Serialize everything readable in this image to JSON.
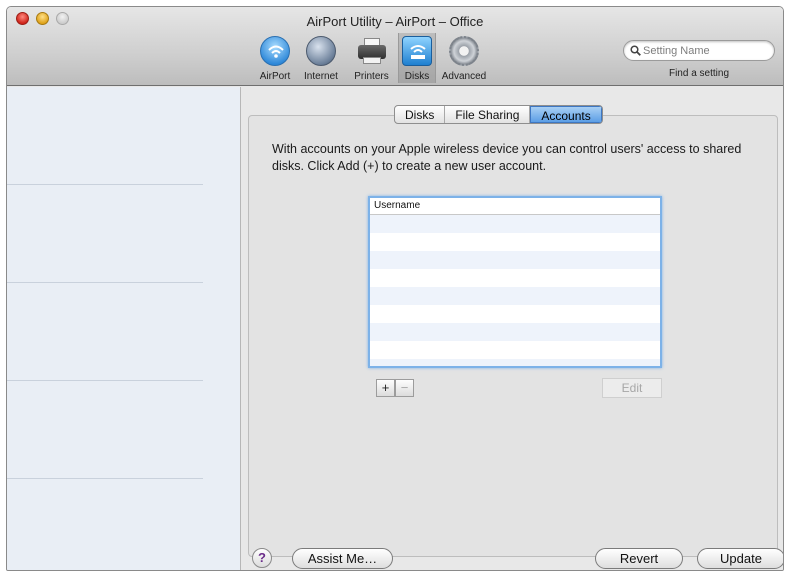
{
  "window": {
    "title": "AirPort Utility – AirPort – Office"
  },
  "toolbar": {
    "items": [
      {
        "label": "AirPort",
        "icon": "airport-wifi-icon"
      },
      {
        "label": "Internet",
        "icon": "internet-globe-icon"
      },
      {
        "label": "Printers",
        "icon": "printer-icon"
      },
      {
        "label": "Disks",
        "icon": "disks-icon"
      },
      {
        "label": "Advanced",
        "icon": "advanced-gear-icon"
      }
    ],
    "selected": "Disks",
    "search": {
      "placeholder": "Setting Name",
      "caption": "Find a setting"
    }
  },
  "tabs": [
    {
      "label": "Disks"
    },
    {
      "label": "File Sharing"
    },
    {
      "label": "Accounts"
    }
  ],
  "selected_tab": "Accounts",
  "accounts": {
    "description": "With accounts on your Apple wireless device you can control users' access to shared disks. Click Add (+) to create a new user account.",
    "table": {
      "columns": [
        "Username"
      ],
      "rows": []
    },
    "add_label": "+",
    "remove_label": "−",
    "edit_label": "Edit"
  },
  "footer": {
    "help_label": "?",
    "assist_label": "Assist Me…",
    "revert_label": "Revert",
    "update_label": "Update"
  },
  "colors": {
    "selection_blue": "#5c9ee6",
    "focus_ring": "#7db2e8",
    "sidebar_bg": "#e9eef5"
  }
}
